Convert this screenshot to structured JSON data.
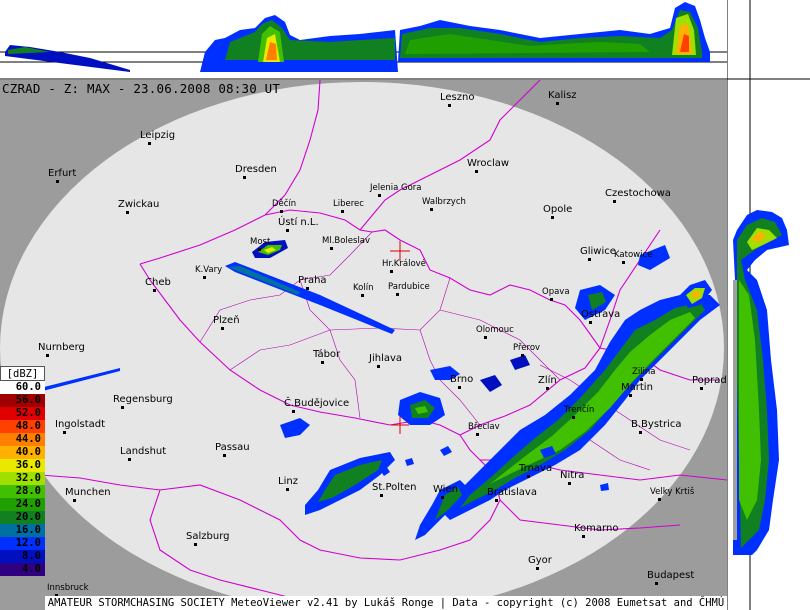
{
  "title": "CZRAD - Z: MAX - 23.06.2008 08:30 UT",
  "footer": "AMATEUR STORMCHASING SOCIETY MeteoViewer v2.41 by Lukáš Ronge | Data - copyright (c) 2008 Eumetsat and ČHMÚ",
  "legend": {
    "header": "[dBZ]",
    "levels": [
      {
        "label": "60.0",
        "color": "#ffffff"
      },
      {
        "label": "56.0",
        "color": "#a00000"
      },
      {
        "label": "52.0",
        "color": "#e00000"
      },
      {
        "label": "48.0",
        "color": "#ff4000"
      },
      {
        "label": "44.0",
        "color": "#ff8000"
      },
      {
        "label": "40.0",
        "color": "#ffb000"
      },
      {
        "label": "36.0",
        "color": "#e8e800"
      },
      {
        "label": "32.0",
        "color": "#a0e000"
      },
      {
        "label": "28.0",
        "color": "#40c000"
      },
      {
        "label": "24.0",
        "color": "#20a000"
      },
      {
        "label": "20.0",
        "color": "#108020"
      },
      {
        "label": "16.0",
        "color": "#0070a0"
      },
      {
        "label": "12.0",
        "color": "#0030ff"
      },
      {
        "label": "8.0",
        "color": "#0010c0"
      },
      {
        "label": "4.0",
        "color": "#300080"
      }
    ]
  },
  "cities": [
    {
      "name": "Leszno"
    },
    {
      "name": "Kalisz"
    },
    {
      "name": "Leipzig"
    },
    {
      "name": "Erfurt"
    },
    {
      "name": "Dresden"
    },
    {
      "name": "Jelenia Gora"
    },
    {
      "name": "Wroclaw"
    },
    {
      "name": "Czestochowa"
    },
    {
      "name": "Zwickau"
    },
    {
      "name": "Děčín"
    },
    {
      "name": "Liberec"
    },
    {
      "name": "Walbrzych"
    },
    {
      "name": "Opole"
    },
    {
      "name": "Ústí n.L."
    },
    {
      "name": "Most"
    },
    {
      "name": "Ml.Boleslav"
    },
    {
      "name": "Gliwice"
    },
    {
      "name": "Katowice"
    },
    {
      "name": "K.Vary"
    },
    {
      "name": "Hr.Králové"
    },
    {
      "name": "Cheb"
    },
    {
      "name": "Praha"
    },
    {
      "name": "Kolín"
    },
    {
      "name": "Pardubice"
    },
    {
      "name": "Opava"
    },
    {
      "name": "Ostrava"
    },
    {
      "name": "Plzeň"
    },
    {
      "name": "Olomouc"
    },
    {
      "name": "Nurnberg"
    },
    {
      "name": "Tábor"
    },
    {
      "name": "Jihlava"
    },
    {
      "name": "Přerov"
    },
    {
      "name": "Zilina"
    },
    {
      "name": "Zlín"
    },
    {
      "name": "Martin"
    },
    {
      "name": "Poprad"
    },
    {
      "name": "Regensburg"
    },
    {
      "name": "Brno"
    },
    {
      "name": "Č.Budějovice"
    },
    {
      "name": "Trenčín"
    },
    {
      "name": "Ingolstadt"
    },
    {
      "name": "B.Bystrica"
    },
    {
      "name": "Břeclav"
    },
    {
      "name": "Landshut"
    },
    {
      "name": "Passau"
    },
    {
      "name": "Trnava"
    },
    {
      "name": "Nitra"
    },
    {
      "name": "Linz"
    },
    {
      "name": "St.Polten"
    },
    {
      "name": "Wien"
    },
    {
      "name": "Bratislava"
    },
    {
      "name": "Velky Krtiš"
    },
    {
      "name": "Munchen"
    },
    {
      "name": "Salzburg"
    },
    {
      "name": "Komarno"
    },
    {
      "name": "Gyor"
    },
    {
      "name": "Budapest"
    },
    {
      "name": "Innsbruck"
    }
  ]
}
